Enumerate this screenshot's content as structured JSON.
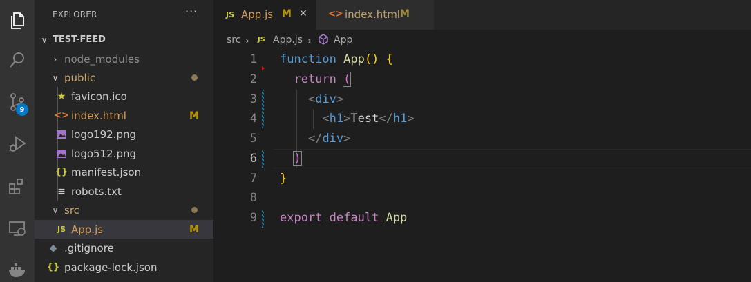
{
  "explorer": {
    "title": "EXPLORER",
    "more": "···",
    "root": "TEST-FEED",
    "items": [
      {
        "label": "node_modules",
        "status": ""
      },
      {
        "label": "public",
        "status": ""
      },
      {
        "label": "favicon.ico",
        "status": ""
      },
      {
        "label": "index.html",
        "status": "M"
      },
      {
        "label": "logo192.png",
        "status": ""
      },
      {
        "label": "logo512.png",
        "status": ""
      },
      {
        "label": "manifest.json",
        "status": ""
      },
      {
        "label": "robots.txt",
        "status": ""
      },
      {
        "label": "src",
        "status": ""
      },
      {
        "label": "App.js",
        "status": "M"
      },
      {
        "label": ".gitignore",
        "status": ""
      },
      {
        "label": "package-lock.json",
        "status": ""
      }
    ]
  },
  "activity": {
    "source_control_badge": "9"
  },
  "tabs": [
    {
      "icon": "JS",
      "label": "App.js",
      "status": "M",
      "close": "✕"
    },
    {
      "icon": "<>",
      "label": "index.html",
      "status": "M"
    }
  ],
  "breadcrumb": {
    "folder": "src",
    "file_icon": "JS",
    "file": "App.js",
    "symbol": "App",
    "sep": "›"
  },
  "editor": {
    "line_numbers": [
      "1",
      "2",
      "3",
      "4",
      "5",
      "6",
      "7",
      "8",
      "9"
    ],
    "l1": {
      "kw": "function",
      "fn": "App",
      "paren": "()",
      "brace": "{"
    },
    "l2": {
      "kw": "return",
      "paren": "("
    },
    "l3": {
      "open": "<",
      "tag": "div",
      "close": ">"
    },
    "l4": {
      "open": "<",
      "tag": "h1",
      "close": ">",
      "text": "Test",
      "open2": "</",
      "tag2": "h1",
      "close2": ">"
    },
    "l5": {
      "open": "</",
      "tag": "div",
      "close": ">"
    },
    "l6": {
      "paren": ")"
    },
    "l7": {
      "brace": "}"
    },
    "l9": {
      "kw1": "export",
      "kw2": "default",
      "fn": "App"
    }
  },
  "colors": {
    "modified": "#b89500",
    "accent": "#007acc",
    "keyword": "#569cd6",
    "control": "#c586c0",
    "function": "#dcdcaa"
  }
}
